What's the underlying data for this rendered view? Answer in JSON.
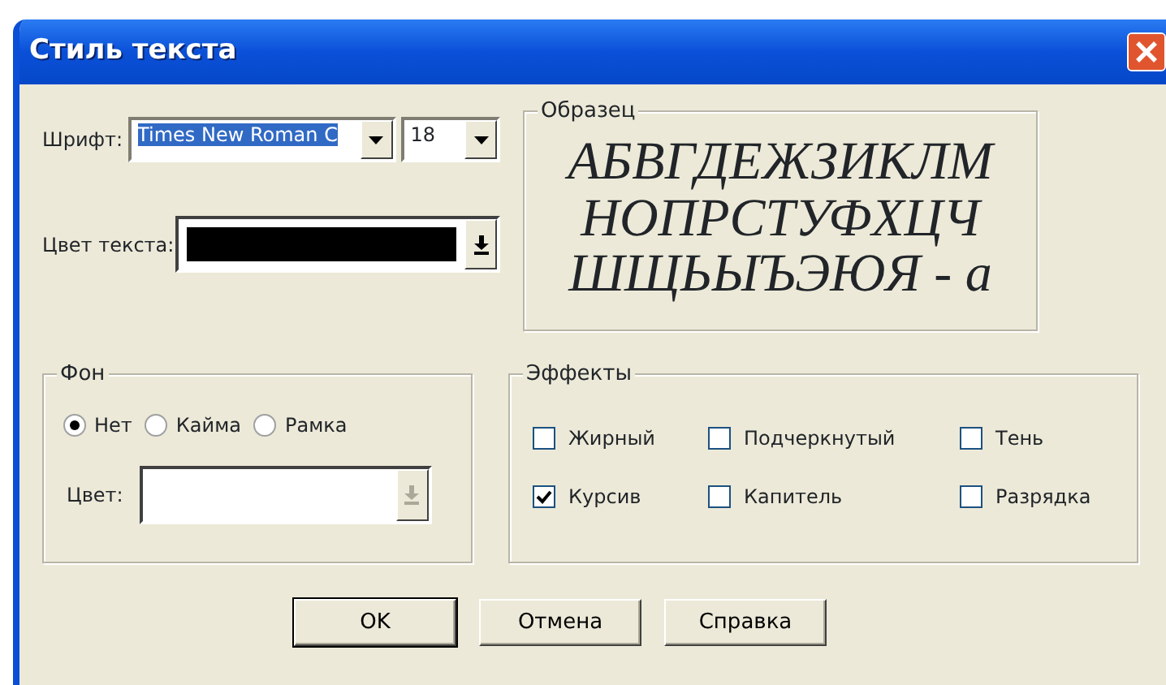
{
  "window": {
    "title": "Стиль текста"
  },
  "font": {
    "label": "Шрифт:",
    "value": "Times New Roman C",
    "selected": true
  },
  "size": {
    "value": "18"
  },
  "text_color": {
    "label": "Цвет текста:",
    "color": "#000000"
  },
  "sample": {
    "title": "Образец",
    "lines": [
      "АБВГДЕЖЗИКЛМ",
      "НОПРСТУФХЦЧ",
      "ШЩЬЫЪЭЮЯ - а"
    ]
  },
  "background": {
    "title": "Фон",
    "options": [
      {
        "label": "Нет",
        "selected": true
      },
      {
        "label": "Кайма",
        "selected": false
      },
      {
        "label": "Рамка",
        "selected": false
      }
    ],
    "color_label": "Цвет:",
    "color_disabled": true
  },
  "effects": {
    "title": "Эффекты",
    "items": [
      {
        "label": "Жирный",
        "checked": false
      },
      {
        "label": "Подчеркнутый",
        "checked": false
      },
      {
        "label": "Тень",
        "checked": false
      },
      {
        "label": "Курсив",
        "checked": true
      },
      {
        "label": "Капитель",
        "checked": false
      },
      {
        "label": "Разрядка",
        "checked": false
      }
    ]
  },
  "buttons": [
    {
      "label": "OK",
      "default": true
    },
    {
      "label": "Отмена",
      "default": false
    },
    {
      "label": "Справка",
      "default": false
    }
  ]
}
